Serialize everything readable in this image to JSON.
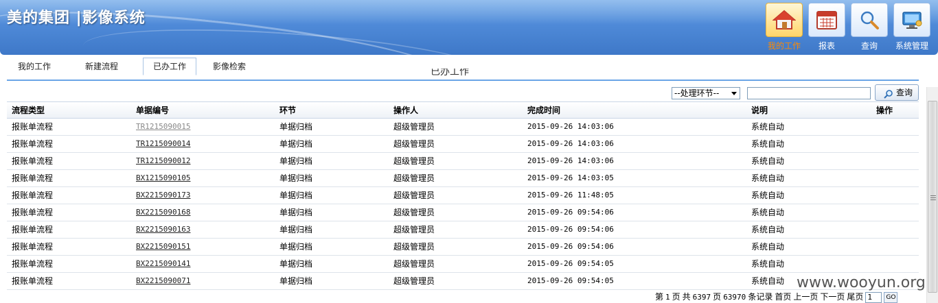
{
  "header": {
    "title": "美的集团 |影像系统",
    "nav": [
      {
        "label": "我的工作",
        "icon": "home-icon",
        "active": true
      },
      {
        "label": "报表",
        "icon": "calendar-report-icon",
        "active": false
      },
      {
        "label": "查询",
        "icon": "magnifier-icon",
        "active": false
      },
      {
        "label": "系统管理",
        "icon": "monitor-settings-icon",
        "active": false
      }
    ]
  },
  "tabs": [
    {
      "label": "我的工作",
      "active": false
    },
    {
      "label": "新建流程",
      "active": false
    },
    {
      "label": "已办工作",
      "active": true
    },
    {
      "label": "影像检索",
      "active": false
    }
  ],
  "page_heading": "已办工作",
  "filter": {
    "select_value": "--处理环节--",
    "search_value": "",
    "search_button": "查询"
  },
  "table": {
    "columns": [
      "流程类型",
      "单据编号",
      "环节",
      "操作人",
      "完成时间",
      "说明",
      "操作"
    ],
    "rows": [
      {
        "type": "报账单流程",
        "doc_no": "TR1215090015",
        "step": "单据归档",
        "operator": "超级管理员",
        "finished": "2015-09-26 14:03:06",
        "note": "系统自动",
        "action": ""
      },
      {
        "type": "报账单流程",
        "doc_no": "TR1215090014",
        "step": "单据归档",
        "operator": "超级管理员",
        "finished": "2015-09-26 14:03:06",
        "note": "系统自动",
        "action": ""
      },
      {
        "type": "报账单流程",
        "doc_no": "TR1215090012",
        "step": "单据归档",
        "operator": "超级管理员",
        "finished": "2015-09-26 14:03:06",
        "note": "系统自动",
        "action": ""
      },
      {
        "type": "报账单流程",
        "doc_no": "BX1215090105",
        "step": "单据归档",
        "operator": "超级管理员",
        "finished": "2015-09-26 14:03:05",
        "note": "系统自动",
        "action": ""
      },
      {
        "type": "报账单流程",
        "doc_no": "BX2215090173",
        "step": "单据归档",
        "operator": "超级管理员",
        "finished": "2015-09-26 11:48:05",
        "note": "系统自动",
        "action": ""
      },
      {
        "type": "报账单流程",
        "doc_no": "BX2215090168",
        "step": "单据归档",
        "operator": "超级管理员",
        "finished": "2015-09-26 09:54:06",
        "note": "系统自动",
        "action": ""
      },
      {
        "type": "报账单流程",
        "doc_no": "BX2215090163",
        "step": "单据归档",
        "operator": "超级管理员",
        "finished": "2015-09-26 09:54:06",
        "note": "系统自动",
        "action": ""
      },
      {
        "type": "报账单流程",
        "doc_no": "BX2215090151",
        "step": "单据归档",
        "operator": "超级管理员",
        "finished": "2015-09-26 09:54:06",
        "note": "系统自动",
        "action": ""
      },
      {
        "type": "报账单流程",
        "doc_no": "BX2215090141",
        "step": "单据归档",
        "operator": "超级管理员",
        "finished": "2015-09-26 09:54:05",
        "note": "系统自动",
        "action": ""
      },
      {
        "type": "报账单流程",
        "doc_no": "BX2215090071",
        "step": "单据归档",
        "operator": "超级管理员",
        "finished": "2015-09-26 09:54:05",
        "note": "系统自动",
        "action": ""
      }
    ]
  },
  "pager": {
    "prefix": "第",
    "current_page": "1",
    "page_unit": "页",
    "total_label": "共",
    "total_pages": "6397",
    "total_pages_unit": "页",
    "total_records": "63970",
    "records_unit": "条记录",
    "first": "首页",
    "prev": "上一页",
    "next": "下一页",
    "last": "尾页",
    "goto_value": "1",
    "go_label": "GO"
  },
  "watermark": "www.wooyun.org",
  "colors": {
    "header_blue": "#4f8ad8",
    "active_nav_text": "#ff8a00",
    "tab_underline": "#6aa5e6"
  }
}
